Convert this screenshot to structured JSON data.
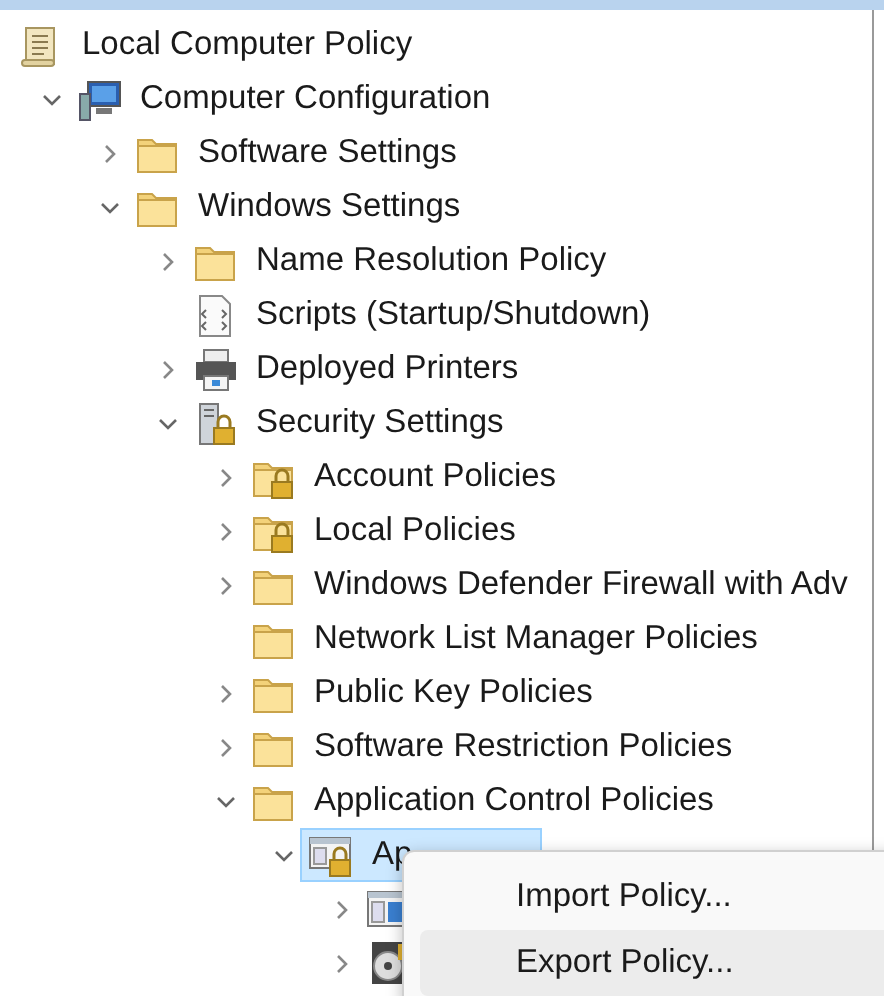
{
  "tree": [
    {
      "label": "Local Computer Policy",
      "kind": "policy",
      "selected": false,
      "children": [
        {
          "label": "Computer Configuration",
          "kind": "computer",
          "selected": false,
          "expanded": true,
          "children": [
            {
              "label": "Software Settings",
              "kind": "folder",
              "selected": false,
              "expanded": false
            },
            {
              "label": "Windows Settings",
              "kind": "folder",
              "selected": false,
              "expanded": true,
              "children": [
                {
                  "label": "Name Resolution Policy",
                  "kind": "folder",
                  "selected": false,
                  "expanded": false
                },
                {
                  "label": "Scripts (Startup/Shutdown)",
                  "kind": "scripts",
                  "selected": false
                },
                {
                  "label": "Deployed Printers",
                  "kind": "printer",
                  "selected": false,
                  "expanded": false
                },
                {
                  "label": "Security Settings",
                  "kind": "security",
                  "selected": false,
                  "expanded": true,
                  "children": [
                    {
                      "label": "Account Policies",
                      "kind": "locked-folder",
                      "selected": false,
                      "expanded": false
                    },
                    {
                      "label": "Local Policies",
                      "kind": "locked-folder",
                      "selected": false,
                      "expanded": false
                    },
                    {
                      "label": "Windows Defender Firewall with Adv",
                      "kind": "folder",
                      "selected": false,
                      "expanded": false
                    },
                    {
                      "label": "Network List Manager Policies",
                      "kind": "folder",
                      "selected": false
                    },
                    {
                      "label": "Public Key Policies",
                      "kind": "folder",
                      "selected": false,
                      "expanded": false
                    },
                    {
                      "label": "Software Restriction Policies",
                      "kind": "folder",
                      "selected": false,
                      "expanded": false
                    },
                    {
                      "label": "Application Control Policies",
                      "kind": "folder",
                      "selected": false,
                      "expanded": true,
                      "children": [
                        {
                          "label": "Ap",
                          "kind": "applocker",
                          "selected": true,
                          "expanded": true,
                          "children": [
                            {
                              "kind": "window",
                              "selected": false,
                              "expanded": false
                            },
                            {
                              "kind": "disc",
                              "selected": false,
                              "expanded": false
                            }
                          ]
                        }
                      ]
                    }
                  ]
                }
              ]
            }
          ]
        }
      ]
    }
  ],
  "context_menu": {
    "items": [
      {
        "label": "Import Policy...",
        "selected": false
      },
      {
        "label": "Export Policy...",
        "selected": true
      }
    ]
  }
}
